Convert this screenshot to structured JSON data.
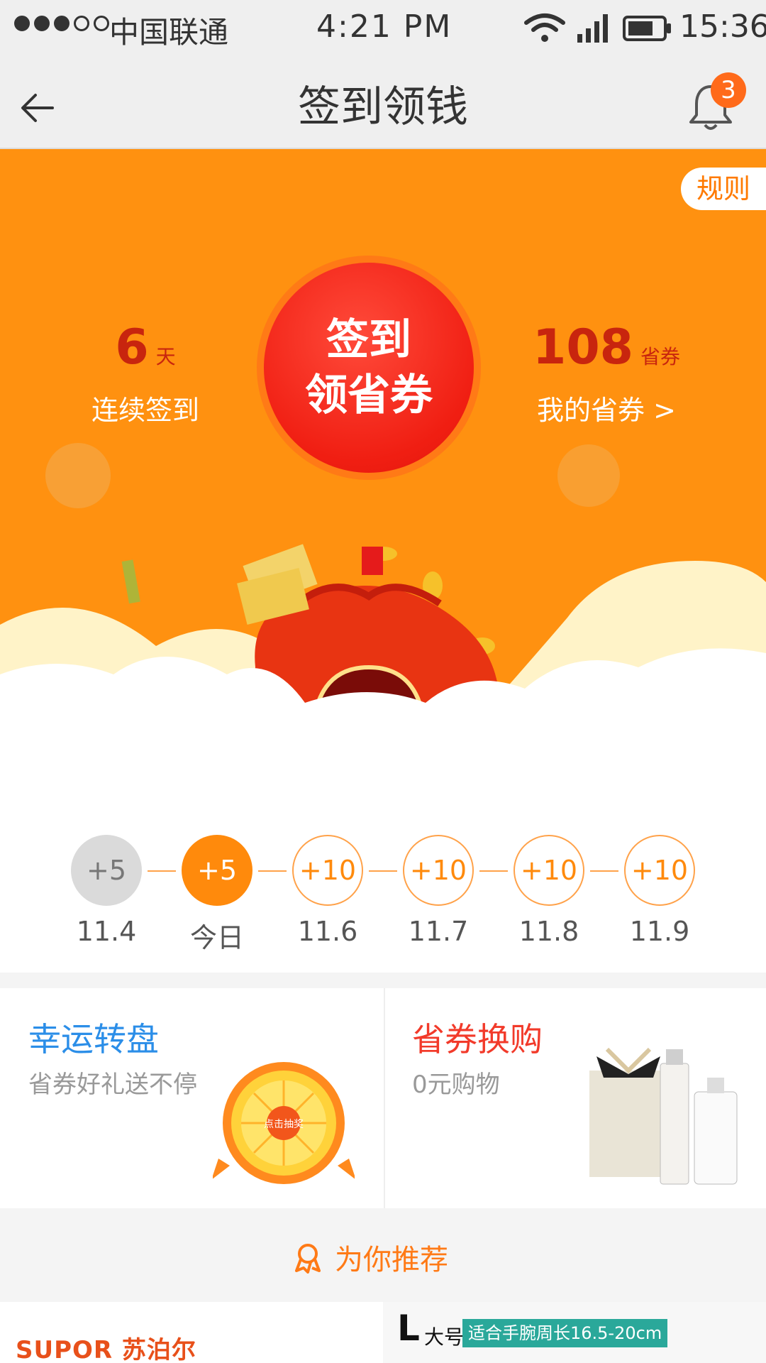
{
  "status_bar": {
    "carrier": "中国联通",
    "time": "4:21 PM",
    "clock": "15:36",
    "signal_strength_dots": 3
  },
  "nav": {
    "title": "签到领钱",
    "notification_count": "3"
  },
  "hero": {
    "rules_label": "规则",
    "streak_value": "6",
    "streak_unit": "天",
    "streak_label": "连续签到",
    "checkin_line1": "签到",
    "checkin_line2": "领省券",
    "coupons_value": "108",
    "coupons_unit": "省券",
    "coupons_label": "我的省券 >"
  },
  "timeline": {
    "steps": [
      {
        "reward": "+5",
        "date": "11.4",
        "state": "past"
      },
      {
        "reward": "+5",
        "date": "今日",
        "state": "today"
      },
      {
        "reward": "+10",
        "date": "11.6",
        "state": "future"
      },
      {
        "reward": "+10",
        "date": "11.7",
        "state": "future"
      },
      {
        "reward": "+10",
        "date": "11.8",
        "state": "future"
      },
      {
        "reward": "+10",
        "date": "11.9",
        "state": "future"
      }
    ]
  },
  "promos": {
    "wheel": {
      "title": "幸运转盘",
      "subtitle": "省券好礼送不停",
      "center_text": "点击抽奖"
    },
    "exchange": {
      "title": "省券换购",
      "subtitle": "0元购物"
    }
  },
  "recommend": {
    "label": "为你推荐"
  },
  "products": {
    "left_brand": "SUPOR 苏泊尔",
    "right_size_letter": "L",
    "right_size_word": "大号",
    "right_fit_text": "适合手腕周长16.5-20cm"
  },
  "colors": {
    "hero_orange": "#ff9110",
    "checkin_red": "#f01e12",
    "accent_orange": "#ff8a0c",
    "wheel_blue": "#2b8ee8",
    "exchange_red": "#f23a2a"
  }
}
